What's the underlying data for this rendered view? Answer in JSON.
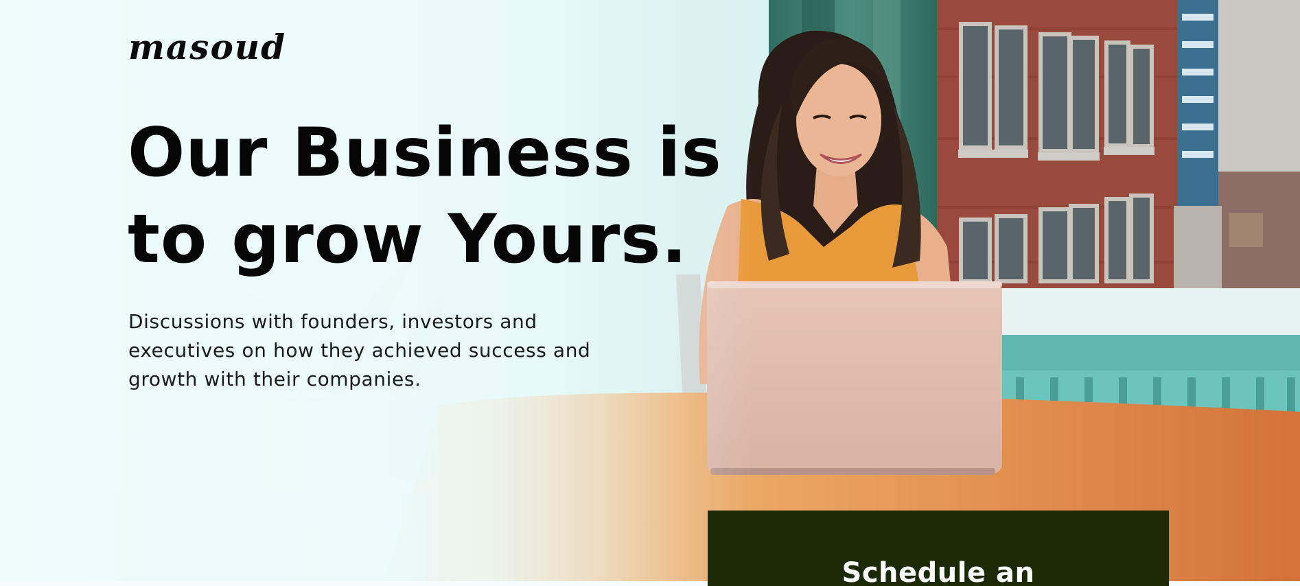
{
  "brand": {
    "logo_text": "masoud"
  },
  "hero": {
    "headline_line1": "Our Business is",
    "headline_line2": "to grow Yours.",
    "description_line1": "Discussions with founders, investors and",
    "description_line2": "executives on how they achieved success and",
    "description_line3": "growth with their companies.",
    "cta_label": "Schedule an"
  },
  "colors": {
    "cta_background": "#1b2a05",
    "text": "#050505",
    "background_tint": "#ecfbfb"
  }
}
